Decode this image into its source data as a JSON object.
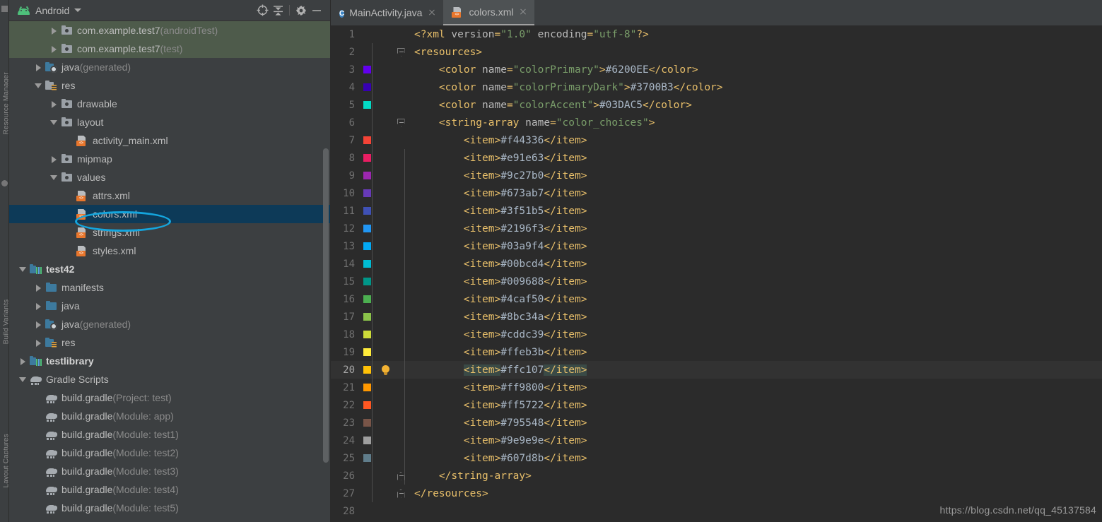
{
  "window": {
    "left_strip_labels": [
      "Resource Manager",
      "Build Variants",
      "Layout Captures"
    ]
  },
  "project_panel": {
    "title": "Android",
    "title_icon": "android-robot-icon",
    "dropdown_icon": "chevron-down-icon",
    "toolbar": [
      {
        "name": "select-opened-file-icon",
        "label": "Select Opened File"
      },
      {
        "name": "collapse-all-icon",
        "label": "Collapse All"
      },
      {
        "name": "settings-gear-icon",
        "label": "Settings"
      },
      {
        "name": "hide-panel-icon",
        "label": "Hide"
      }
    ],
    "tree": [
      {
        "indent": 2,
        "arrow": "right",
        "icon": "folder-gray",
        "label": "com.example.test7",
        "suffix": " (androidTest)",
        "state": "highlighted-green"
      },
      {
        "indent": 2,
        "arrow": "right",
        "icon": "folder-gray",
        "label": "com.example.test7",
        "suffix": " (test)",
        "state": "highlighted-green"
      },
      {
        "indent": 1,
        "arrow": "right",
        "icon": "folder-gen",
        "label": "java",
        "suffix": " (generated)",
        "state": "normal"
      },
      {
        "indent": 1,
        "arrow": "down",
        "icon": "folder-res",
        "label": "res",
        "suffix": "",
        "state": "normal"
      },
      {
        "indent": 2,
        "arrow": "right",
        "icon": "folder-gray",
        "label": "drawable",
        "suffix": "",
        "state": "normal"
      },
      {
        "indent": 2,
        "arrow": "down",
        "icon": "folder-gray",
        "label": "layout",
        "suffix": "",
        "state": "normal"
      },
      {
        "indent": 3,
        "arrow": "none",
        "icon": "xml-file",
        "label": "activity_main.xml",
        "suffix": "",
        "state": "normal"
      },
      {
        "indent": 2,
        "arrow": "right",
        "icon": "folder-gray",
        "label": "mipmap",
        "suffix": "",
        "state": "normal"
      },
      {
        "indent": 2,
        "arrow": "down",
        "icon": "folder-gray",
        "label": "values",
        "suffix": "",
        "state": "normal"
      },
      {
        "indent": 3,
        "arrow": "none",
        "icon": "xml-file",
        "label": "attrs.xml",
        "suffix": "",
        "state": "normal"
      },
      {
        "indent": 3,
        "arrow": "none",
        "icon": "xml-file",
        "label": "colors.xml",
        "suffix": "",
        "state": "selected"
      },
      {
        "indent": 3,
        "arrow": "none",
        "icon": "xml-file",
        "label": "strings.xml",
        "suffix": "",
        "state": "normal"
      },
      {
        "indent": 3,
        "arrow": "none",
        "icon": "xml-file",
        "label": "styles.xml",
        "suffix": "",
        "state": "normal"
      },
      {
        "indent": 0,
        "arrow": "down",
        "icon": "module",
        "label": "test42",
        "suffix": "",
        "state": "bold"
      },
      {
        "indent": 1,
        "arrow": "right",
        "icon": "folder-blue",
        "label": "manifests",
        "suffix": "",
        "state": "normal"
      },
      {
        "indent": 1,
        "arrow": "right",
        "icon": "folder-blue",
        "label": "java",
        "suffix": "",
        "state": "normal"
      },
      {
        "indent": 1,
        "arrow": "right",
        "icon": "folder-gen",
        "label": "java",
        "suffix": " (generated)",
        "state": "normal"
      },
      {
        "indent": 1,
        "arrow": "right",
        "icon": "folder-resb",
        "label": "res",
        "suffix": "",
        "state": "normal"
      },
      {
        "indent": 0,
        "arrow": "right",
        "icon": "module",
        "label": "testlibrary",
        "suffix": "",
        "state": "bold"
      },
      {
        "indent": 0,
        "arrow": "down",
        "icon": "gradle",
        "label": "Gradle Scripts",
        "suffix": "",
        "state": "normal"
      },
      {
        "indent": 1,
        "arrow": "none",
        "icon": "gradle",
        "label": "build.gradle",
        "suffix": " (Project: test)",
        "state": "normal"
      },
      {
        "indent": 1,
        "arrow": "none",
        "icon": "gradle",
        "label": "build.gradle",
        "suffix": " (Module: app)",
        "state": "normal"
      },
      {
        "indent": 1,
        "arrow": "none",
        "icon": "gradle",
        "label": "build.gradle",
        "suffix": " (Module: test1)",
        "state": "normal"
      },
      {
        "indent": 1,
        "arrow": "none",
        "icon": "gradle",
        "label": "build.gradle",
        "suffix": " (Module: test2)",
        "state": "normal"
      },
      {
        "indent": 1,
        "arrow": "none",
        "icon": "gradle",
        "label": "build.gradle",
        "suffix": " (Module: test3)",
        "state": "normal"
      },
      {
        "indent": 1,
        "arrow": "none",
        "icon": "gradle",
        "label": "build.gradle",
        "suffix": " (Module: test4)",
        "state": "normal"
      },
      {
        "indent": 1,
        "arrow": "none",
        "icon": "gradle",
        "label": "build.gradle",
        "suffix": " (Module: test5)",
        "state": "normal"
      }
    ],
    "annotation": {
      "shape": "ellipse",
      "color": "#14a5dd",
      "targets": "colors.xml"
    }
  },
  "editor": {
    "tabs": [
      {
        "label": "MainActivity.java",
        "icon": "java-class-icon",
        "active": false,
        "closable": true
      },
      {
        "label": "colors.xml",
        "icon": "xml-file-icon",
        "active": true,
        "closable": true
      }
    ],
    "current_line": 20,
    "lines": [
      {
        "n": 1,
        "indent": 0,
        "swatch": null,
        "fold": null,
        "bulb": false,
        "tokens": [
          {
            "t": "tag",
            "v": "<?xml "
          },
          {
            "t": "attr",
            "v": "version"
          },
          {
            "t": "tag",
            "v": "="
          },
          {
            "t": "val",
            "v": "\"1.0\""
          },
          {
            "t": "attr",
            "v": " encoding"
          },
          {
            "t": "tag",
            "v": "="
          },
          {
            "t": "val",
            "v": "\"utf-8\""
          },
          {
            "t": "tag",
            "v": "?>"
          }
        ]
      },
      {
        "n": 2,
        "indent": 0,
        "swatch": null,
        "fold": "down",
        "bulb": false,
        "tokens": [
          {
            "t": "tag",
            "v": "<resources>"
          }
        ]
      },
      {
        "n": 3,
        "indent": 1,
        "swatch": "#6200EE",
        "fold": null,
        "bulb": false,
        "tokens": [
          {
            "t": "tag",
            "v": "<color "
          },
          {
            "t": "attr",
            "v": "name"
          },
          {
            "t": "tag",
            "v": "="
          },
          {
            "t": "val",
            "v": "\"colorPrimary\""
          },
          {
            "t": "tag",
            "v": ">"
          },
          {
            "t": "txt",
            "v": "#6200EE"
          },
          {
            "t": "tag",
            "v": "</color>"
          }
        ]
      },
      {
        "n": 4,
        "indent": 1,
        "swatch": "#3700B3",
        "fold": null,
        "bulb": false,
        "tokens": [
          {
            "t": "tag",
            "v": "<color "
          },
          {
            "t": "attr",
            "v": "name"
          },
          {
            "t": "tag",
            "v": "="
          },
          {
            "t": "val",
            "v": "\"colorPrimaryDark\""
          },
          {
            "t": "tag",
            "v": ">"
          },
          {
            "t": "txt",
            "v": "#3700B3"
          },
          {
            "t": "tag",
            "v": "</color>"
          }
        ]
      },
      {
        "n": 5,
        "indent": 1,
        "swatch": "#03DAC5",
        "fold": null,
        "bulb": false,
        "tokens": [
          {
            "t": "tag",
            "v": "<color "
          },
          {
            "t": "attr",
            "v": "name"
          },
          {
            "t": "tag",
            "v": "="
          },
          {
            "t": "val",
            "v": "\"colorAccent\""
          },
          {
            "t": "tag",
            "v": ">"
          },
          {
            "t": "txt",
            "v": "#03DAC5"
          },
          {
            "t": "tag",
            "v": "</color>"
          }
        ]
      },
      {
        "n": 6,
        "indent": 1,
        "swatch": null,
        "fold": "down",
        "bulb": false,
        "tokens": [
          {
            "t": "tag",
            "v": "<string-array "
          },
          {
            "t": "attr",
            "v": "name"
          },
          {
            "t": "tag",
            "v": "="
          },
          {
            "t": "val",
            "v": "\"color_choices\""
          },
          {
            "t": "tag",
            "v": ">"
          }
        ]
      },
      {
        "n": 7,
        "indent": 2,
        "swatch": "#f44336",
        "fold": null,
        "bulb": false,
        "tokens": [
          {
            "t": "tag",
            "v": "<item>"
          },
          {
            "t": "txt",
            "v": "#f44336"
          },
          {
            "t": "tag",
            "v": "</item>"
          }
        ]
      },
      {
        "n": 8,
        "indent": 2,
        "swatch": "#e91e63",
        "fold": null,
        "bulb": false,
        "tokens": [
          {
            "t": "tag",
            "v": "<item>"
          },
          {
            "t": "txt",
            "v": "#e91e63"
          },
          {
            "t": "tag",
            "v": "</item>"
          }
        ]
      },
      {
        "n": 9,
        "indent": 2,
        "swatch": "#9c27b0",
        "fold": null,
        "bulb": false,
        "tokens": [
          {
            "t": "tag",
            "v": "<item>"
          },
          {
            "t": "txt",
            "v": "#9c27b0"
          },
          {
            "t": "tag",
            "v": "</item>"
          }
        ]
      },
      {
        "n": 10,
        "indent": 2,
        "swatch": "#673ab7",
        "fold": null,
        "bulb": false,
        "tokens": [
          {
            "t": "tag",
            "v": "<item>"
          },
          {
            "t": "txt",
            "v": "#673ab7"
          },
          {
            "t": "tag",
            "v": "</item>"
          }
        ]
      },
      {
        "n": 11,
        "indent": 2,
        "swatch": "#3f51b5",
        "fold": null,
        "bulb": false,
        "tokens": [
          {
            "t": "tag",
            "v": "<item>"
          },
          {
            "t": "txt",
            "v": "#3f51b5"
          },
          {
            "t": "tag",
            "v": "</item>"
          }
        ]
      },
      {
        "n": 12,
        "indent": 2,
        "swatch": "#2196f3",
        "fold": null,
        "bulb": false,
        "tokens": [
          {
            "t": "tag",
            "v": "<item>"
          },
          {
            "t": "txt",
            "v": "#2196f3"
          },
          {
            "t": "tag",
            "v": "</item>"
          }
        ]
      },
      {
        "n": 13,
        "indent": 2,
        "swatch": "#03a9f4",
        "fold": null,
        "bulb": false,
        "tokens": [
          {
            "t": "tag",
            "v": "<item>"
          },
          {
            "t": "txt",
            "v": "#03a9f4"
          },
          {
            "t": "tag",
            "v": "</item>"
          }
        ]
      },
      {
        "n": 14,
        "indent": 2,
        "swatch": "#00bcd4",
        "fold": null,
        "bulb": false,
        "tokens": [
          {
            "t": "tag",
            "v": "<item>"
          },
          {
            "t": "txt",
            "v": "#00bcd4"
          },
          {
            "t": "tag",
            "v": "</item>"
          }
        ]
      },
      {
        "n": 15,
        "indent": 2,
        "swatch": "#009688",
        "fold": null,
        "bulb": false,
        "tokens": [
          {
            "t": "tag",
            "v": "<item>"
          },
          {
            "t": "txt",
            "v": "#009688"
          },
          {
            "t": "tag",
            "v": "</item>"
          }
        ]
      },
      {
        "n": 16,
        "indent": 2,
        "swatch": "#4caf50",
        "fold": null,
        "bulb": false,
        "tokens": [
          {
            "t": "tag",
            "v": "<item>"
          },
          {
            "t": "txt",
            "v": "#4caf50"
          },
          {
            "t": "tag",
            "v": "</item>"
          }
        ]
      },
      {
        "n": 17,
        "indent": 2,
        "swatch": "#8bc34a",
        "fold": null,
        "bulb": false,
        "tokens": [
          {
            "t": "tag",
            "v": "<item>"
          },
          {
            "t": "txt",
            "v": "#8bc34a"
          },
          {
            "t": "tag",
            "v": "</item>"
          }
        ]
      },
      {
        "n": 18,
        "indent": 2,
        "swatch": "#cddc39",
        "fold": null,
        "bulb": false,
        "tokens": [
          {
            "t": "tag",
            "v": "<item>"
          },
          {
            "t": "txt",
            "v": "#cddc39"
          },
          {
            "t": "tag",
            "v": "</item>"
          }
        ]
      },
      {
        "n": 19,
        "indent": 2,
        "swatch": "#ffeb3b",
        "fold": null,
        "bulb": false,
        "tokens": [
          {
            "t": "tag",
            "v": "<item>"
          },
          {
            "t": "txt",
            "v": "#ffeb3b"
          },
          {
            "t": "tag",
            "v": "</item>"
          }
        ]
      },
      {
        "n": 20,
        "indent": 2,
        "swatch": "#ffc107",
        "fold": null,
        "bulb": true,
        "current": true,
        "tokens": [
          {
            "t": "tag hl",
            "v": "<item>"
          },
          {
            "t": "txt",
            "v": "#ffc107"
          },
          {
            "t": "tag hl",
            "v": "</item>"
          }
        ]
      },
      {
        "n": 21,
        "indent": 2,
        "swatch": "#ff9800",
        "fold": null,
        "bulb": false,
        "tokens": [
          {
            "t": "tag",
            "v": "<item>"
          },
          {
            "t": "txt",
            "v": "#ff9800"
          },
          {
            "t": "tag",
            "v": "</item>"
          }
        ]
      },
      {
        "n": 22,
        "indent": 2,
        "swatch": "#ff5722",
        "fold": null,
        "bulb": false,
        "tokens": [
          {
            "t": "tag",
            "v": "<item>"
          },
          {
            "t": "txt",
            "v": "#ff5722"
          },
          {
            "t": "tag",
            "v": "</item>"
          }
        ]
      },
      {
        "n": 23,
        "indent": 2,
        "swatch": "#795548",
        "fold": null,
        "bulb": false,
        "tokens": [
          {
            "t": "tag",
            "v": "<item>"
          },
          {
            "t": "txt",
            "v": "#795548"
          },
          {
            "t": "tag",
            "v": "</item>"
          }
        ]
      },
      {
        "n": 24,
        "indent": 2,
        "swatch": "#9e9e9e",
        "fold": null,
        "bulb": false,
        "tokens": [
          {
            "t": "tag",
            "v": "<item>"
          },
          {
            "t": "txt",
            "v": "#9e9e9e"
          },
          {
            "t": "tag",
            "v": "</item>"
          }
        ]
      },
      {
        "n": 25,
        "indent": 2,
        "swatch": "#607d8b",
        "fold": null,
        "bulb": false,
        "tokens": [
          {
            "t": "tag",
            "v": "<item>"
          },
          {
            "t": "txt",
            "v": "#607d8b"
          },
          {
            "t": "tag",
            "v": "</item>"
          }
        ]
      },
      {
        "n": 26,
        "indent": 1,
        "swatch": null,
        "fold": "up",
        "bulb": false,
        "tokens": [
          {
            "t": "tag",
            "v": "</string-array>"
          }
        ]
      },
      {
        "n": 27,
        "indent": 0,
        "swatch": null,
        "fold": "up",
        "bulb": false,
        "tokens": [
          {
            "t": "tag",
            "v": "</resources>"
          }
        ]
      },
      {
        "n": 28,
        "indent": 0,
        "swatch": null,
        "fold": null,
        "bulb": false,
        "tokens": []
      }
    ]
  },
  "watermark": "https://blog.csdn.net/qq_45137584"
}
